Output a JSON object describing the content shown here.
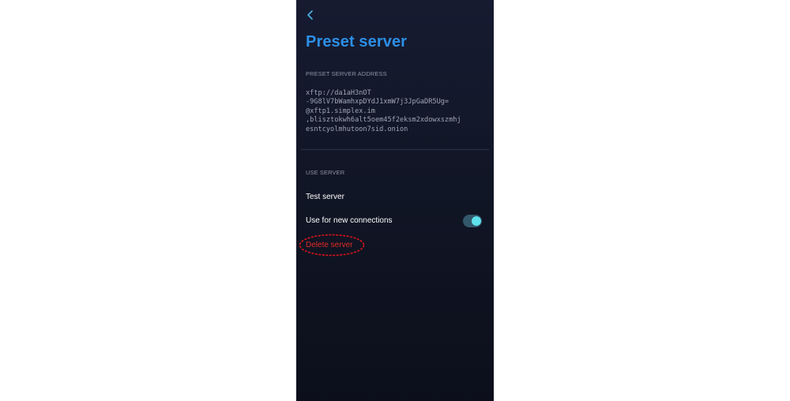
{
  "header": {
    "back_icon": "chevron-left-icon",
    "title": "Preset server"
  },
  "preset_address": {
    "label": "PRESET SERVER ADDRESS",
    "lines": [
      "xftp://da1aH3nOT",
      "-9G8lV7bWamhxpDYdJ1xmW7j3JpGaDR5Ug=",
      "@xftp1.simplex.im",
      ",bliszto​kwh6alt5oem45f2eksm2xdowxszmhj",
      "esntcyolmhutoon7sid.onion"
    ]
  },
  "use_server": {
    "label": "USE SERVER",
    "test_label": "Test server",
    "new_connections_label": "Use for new connections",
    "new_connections_enabled": true,
    "delete_label": "Delete server"
  },
  "colors": {
    "title": "#2d8fe6",
    "toggle_track": "#33576a",
    "toggle_knob": "#5fe1ec",
    "delete": "#e12c26",
    "annotation": "#e0141a"
  }
}
